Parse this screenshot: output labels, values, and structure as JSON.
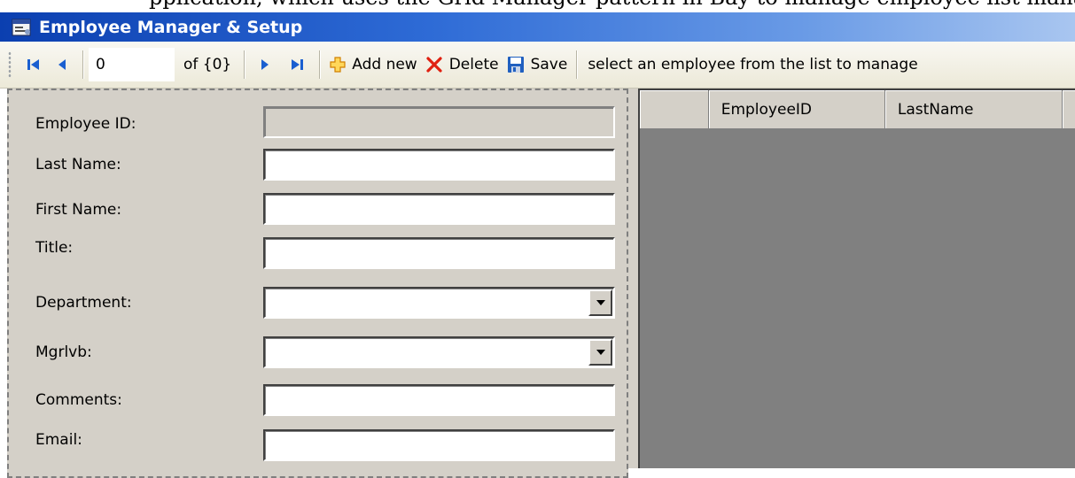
{
  "page_fragment": "pplication, which uses the Grid Manager pattern in Bay to manage employee list management.",
  "window": {
    "title": "Employee Manager & Setup",
    "icon": "app-window-icon"
  },
  "toolbar": {
    "position_value": "0",
    "of_label": "of {0}",
    "add_new_label": "Add new",
    "delete_label": "Delete",
    "save_label": "Save",
    "hint": "select an employee from the list to manage",
    "icons": [
      "first-record-icon",
      "previous-record-icon",
      "next-record-icon",
      "last-record-icon",
      "add-icon",
      "delete-icon",
      "save-icon"
    ],
    "colors": {
      "nav_blue": "#1a5fd0",
      "add_orange": "#f0a020",
      "delete_red": "#e02010",
      "save_blue": "#2060c0"
    }
  },
  "form": {
    "fields": [
      {
        "label": "Employee ID:",
        "type": "text",
        "disabled": true,
        "value": ""
      },
      {
        "label": "Last Name:",
        "type": "text",
        "value": ""
      },
      {
        "label": "First Name:",
        "type": "text",
        "value": ""
      },
      {
        "label": "Title:",
        "type": "text",
        "value": ""
      },
      {
        "label": "Department:",
        "type": "dropdown",
        "value": ""
      },
      {
        "label": "Mgrlvb:",
        "type": "dropdown",
        "value": ""
      },
      {
        "label": "Comments:",
        "type": "text",
        "value": ""
      },
      {
        "label": "Email:",
        "type": "text",
        "value": ""
      }
    ]
  },
  "grid": {
    "columns": [
      "",
      "EmployeeID",
      "LastName"
    ],
    "rows": []
  }
}
